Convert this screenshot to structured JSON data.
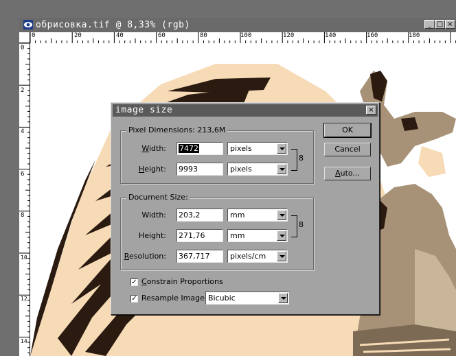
{
  "document": {
    "title": "обрисовка.tif @ 8,33% (rgb)",
    "buttons": {
      "minimize": "_",
      "maximize": "□",
      "close": "×"
    },
    "ruler_top_ticks": [
      "0",
      "20",
      "40",
      "60",
      "80",
      "100",
      "120",
      "140",
      "160",
      "180"
    ],
    "ruler_left_ticks": [
      "0",
      "2",
      "4",
      "6",
      "8",
      "10",
      "12",
      "14"
    ]
  },
  "canvas": {
    "colors": {
      "dark": "#2a1a10",
      "mid": "#a89277",
      "light": "#f6dbb6",
      "tan": "#c9b597",
      "shadow": "#7d6a55"
    }
  },
  "dialog": {
    "title": "image size",
    "close_label": "×",
    "pixel_dimensions": {
      "label": "Pixel Dimensions:  213,6M",
      "width": {
        "label": "Width:",
        "value": "7472",
        "unit": "pixels"
      },
      "height": {
        "label": "Height:",
        "value": "9993",
        "unit": "pixels"
      }
    },
    "document_size": {
      "label": "Document Size:",
      "width": {
        "label": "Width:",
        "value": "203,2",
        "unit": "mm"
      },
      "height": {
        "label": "Height:",
        "value": "271,76",
        "unit": "mm"
      },
      "resolution": {
        "label": "Resolution:",
        "value": "367,717",
        "unit": "pixels/cm"
      }
    },
    "constrain": {
      "label": "Constrain Proportions",
      "checked": "✓"
    },
    "resample": {
      "label": "Resample Image:",
      "checked": "✓",
      "method": "Bicubic"
    },
    "buttons": {
      "ok": "OK",
      "cancel": "Cancel",
      "auto": "Auto..."
    },
    "chain_glyph": "8"
  }
}
